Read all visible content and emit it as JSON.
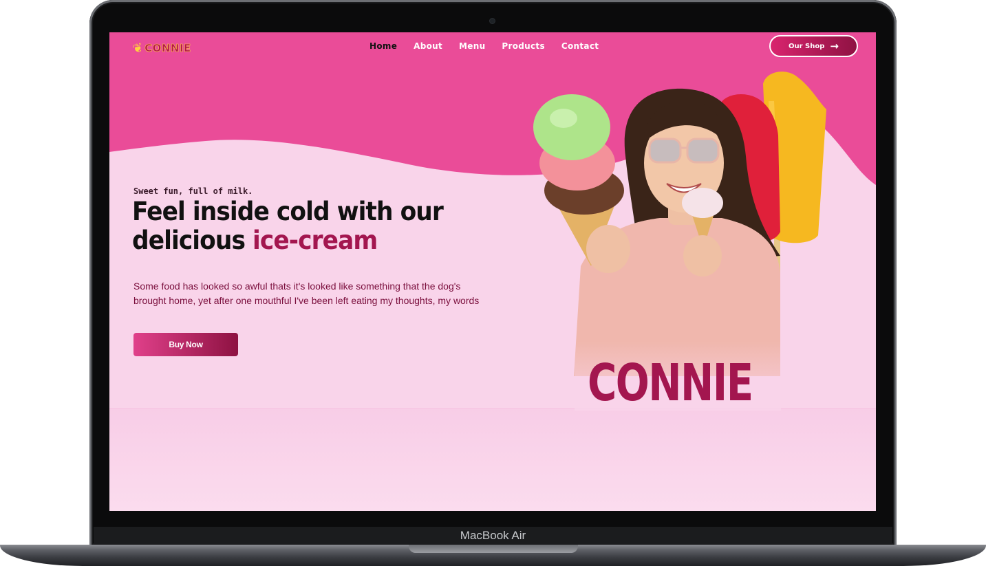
{
  "device": {
    "label": "MacBook Air"
  },
  "nav": {
    "logo_text": "CONNIE",
    "items": [
      {
        "label": "Home",
        "active": true
      },
      {
        "label": "About"
      },
      {
        "label": "Menu"
      },
      {
        "label": "Products"
      },
      {
        "label": "Contact"
      }
    ],
    "shop_button": "Our Shop"
  },
  "hero": {
    "eyebrow": "Sweet fun, full of milk.",
    "headline_line1": "Feel inside cold with our",
    "headline_line2_plain": "delicious ",
    "headline_line2_accent": "ice-cream",
    "paragraph": "Some food has looked so awful thats it's looked like something that the dog's brought home, yet after one mouthful I've been left eating my thoughts, my words",
    "buy_button": "Buy Now",
    "brand_overlay": "CONNIE"
  },
  "colors": {
    "primary_pink": "#ea4c98",
    "light_pink": "#f9d4ea",
    "accent_magenta": "#a3164f"
  }
}
